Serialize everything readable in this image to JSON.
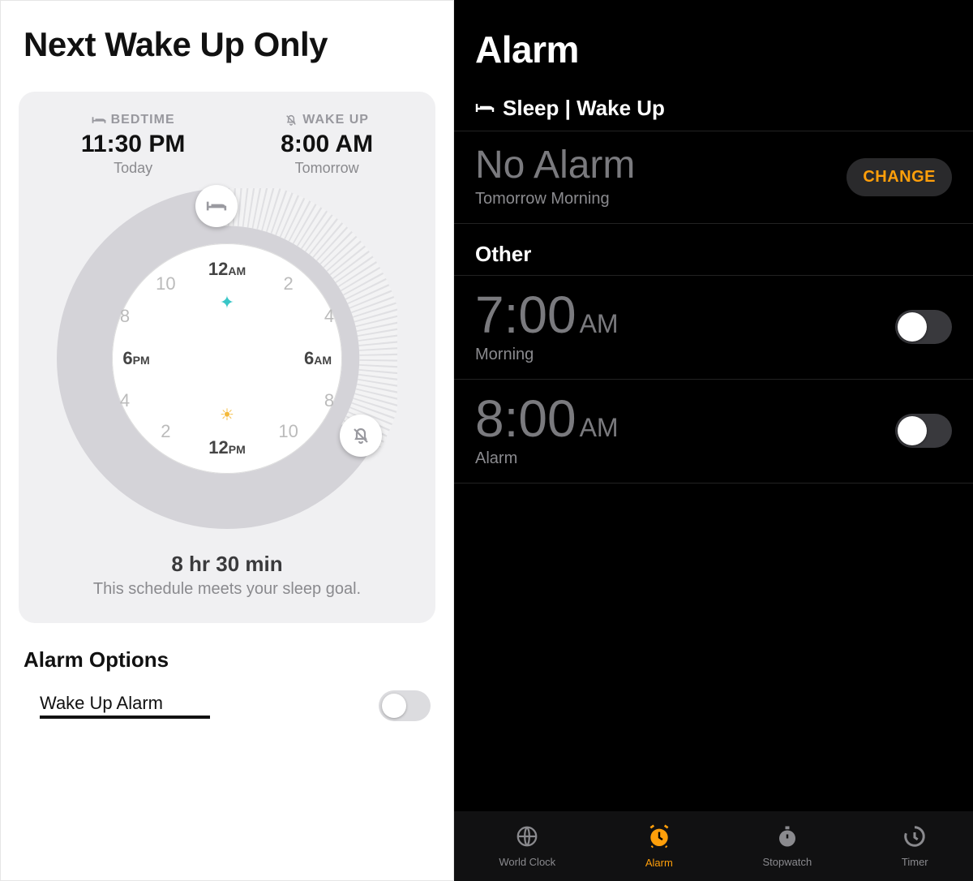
{
  "left": {
    "title": "Next Wake Up Only",
    "card": {
      "bedtime_label": "BEDTIME",
      "bedtime_time": "11:30 PM",
      "bedtime_day": "Today",
      "wakeup_label": "WAKE UP",
      "wakeup_time": "8:00 AM",
      "wakeup_day": "Tomorrow",
      "dial": {
        "top": "12AM",
        "h2": "2",
        "h4": "4",
        "right": "6AM",
        "h8r": "8",
        "h10r": "10",
        "bottom": "12PM",
        "h2l": "2",
        "h4l": "4",
        "left": "6PM",
        "h8l": "8",
        "h10l": "10"
      },
      "duration": "8 hr 30 min",
      "duration_note": "This schedule meets your sleep goal."
    },
    "options": {
      "header": "Alarm Options",
      "wake_label": "Wake Up Alarm",
      "wake_enabled": false
    }
  },
  "right": {
    "title": "Alarm",
    "sleep_section": "Sleep | Wake Up",
    "no_alarm": "No Alarm",
    "no_alarm_sub": "Tomorrow Morning",
    "change_label": "CHANGE",
    "other_header": "Other",
    "alarms": [
      {
        "time": "7:00",
        "ampm": "AM",
        "label": "Morning",
        "enabled": false
      },
      {
        "time": "8:00",
        "ampm": "AM",
        "label": "Alarm",
        "enabled": false
      }
    ],
    "tabs": [
      {
        "key": "world-clock",
        "label": "World Clock",
        "active": false
      },
      {
        "key": "alarm",
        "label": "Alarm",
        "active": true
      },
      {
        "key": "stopwatch",
        "label": "Stopwatch",
        "active": false
      },
      {
        "key": "timer",
        "label": "Timer",
        "active": false
      }
    ]
  }
}
